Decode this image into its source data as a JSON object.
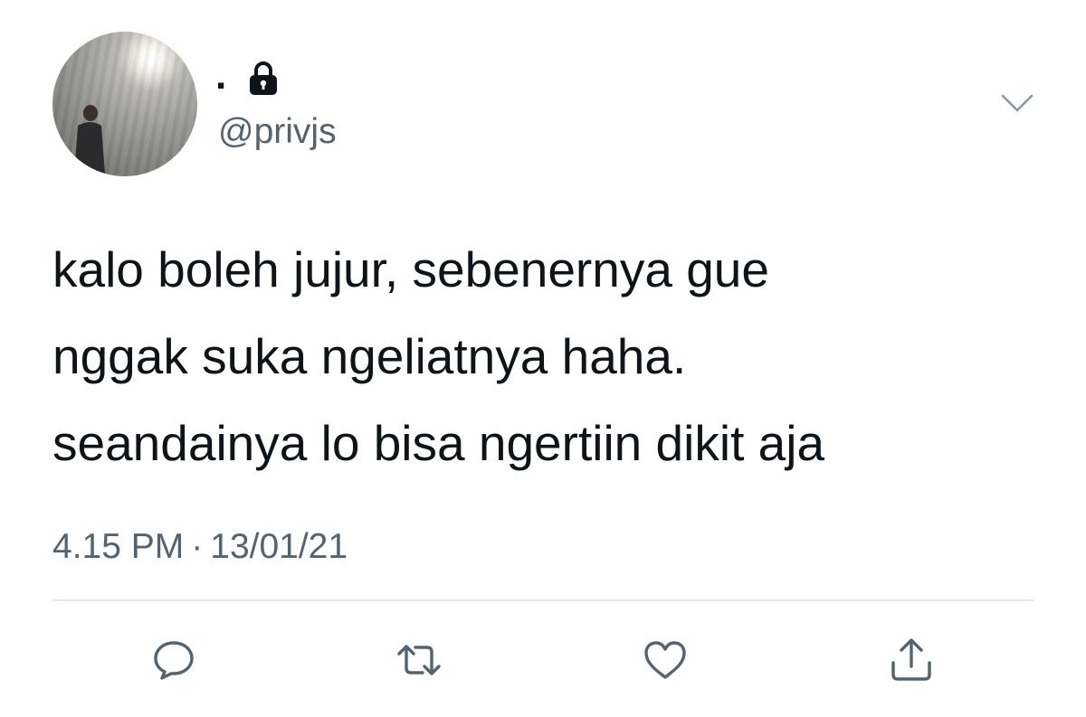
{
  "user": {
    "display_name": ".",
    "handle": "@privjs",
    "protected_icon": "lock-icon",
    "avatar_icon": "profile-photo"
  },
  "tweet": {
    "lines": [
      "kalo boleh jujur, sebenernya gue",
      "nggak suka ngeliatnya haha.",
      "seandainya lo bisa ngertiin dikit aja"
    ],
    "time": "4.15 PM",
    "separator": "·",
    "date": "13/01/21"
  },
  "actions": [
    {
      "name": "reply",
      "icon": "reply-bubble-icon"
    },
    {
      "name": "retweet",
      "icon": "retweet-icon"
    },
    {
      "name": "like",
      "icon": "heart-icon"
    },
    {
      "name": "share",
      "icon": "share-icon"
    }
  ],
  "colors": {
    "text": "#0f1419",
    "secondary": "#536471",
    "icon": "#536471",
    "divider": "#e6e8ea",
    "background": "#ffffff"
  }
}
